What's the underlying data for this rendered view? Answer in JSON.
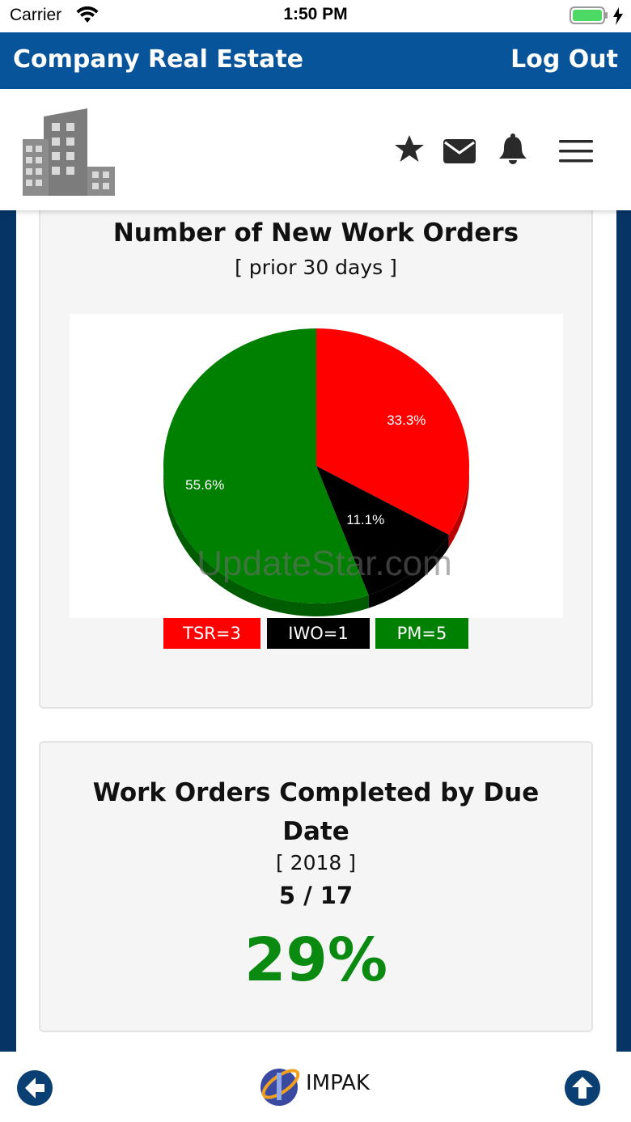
{
  "status_bar": {
    "carrier": "Carrier",
    "time": "1:50 PM"
  },
  "app_bar": {
    "title": "Company Real Estate",
    "logout_label": "Log Out"
  },
  "header": {
    "icons": [
      "star-icon",
      "mail-icon",
      "bell-icon",
      "menu-icon"
    ]
  },
  "new_orders_card": {
    "title": "Number of New Work Orders",
    "subtitle": "[ prior 30 days ]",
    "watermark": "UpdateStar.com",
    "legend": [
      {
        "label": "TSR=3",
        "color": "#ff0000",
        "text_color": "#ffffff"
      },
      {
        "label": "IWO=1",
        "color": "#000000",
        "text_color": "#ffffff"
      },
      {
        "label": "PM=5",
        "color": "#008000",
        "text_color": "#ffffff"
      }
    ]
  },
  "chart_data": {
    "type": "pie",
    "title": "Number of New Work Orders",
    "subtitle": "[ prior 30 days ]",
    "slices": [
      {
        "name": "TSR",
        "value": 3,
        "label": "33.3%",
        "color": "#ff0000"
      },
      {
        "name": "IWO",
        "value": 1,
        "label": "11.1%",
        "color": "#000000"
      },
      {
        "name": "PM",
        "value": 5,
        "label": "55.6%",
        "color": "#008000"
      }
    ],
    "legend": [
      "TSR=3",
      "IWO=1",
      "PM=5"
    ],
    "legend_position": "bottom"
  },
  "completed_card": {
    "title": "Work Orders Completed by Due Date",
    "subtitle": "[ 2018 ]",
    "ratio": "5 / 17",
    "percent": "29%",
    "percent_color": "#0a8a10"
  },
  "bottom_bar": {
    "brand": "IMPAK"
  },
  "colors": {
    "app_bar": "#07549a",
    "page_frame": "#063565",
    "accent_green": "#0a8a10"
  }
}
